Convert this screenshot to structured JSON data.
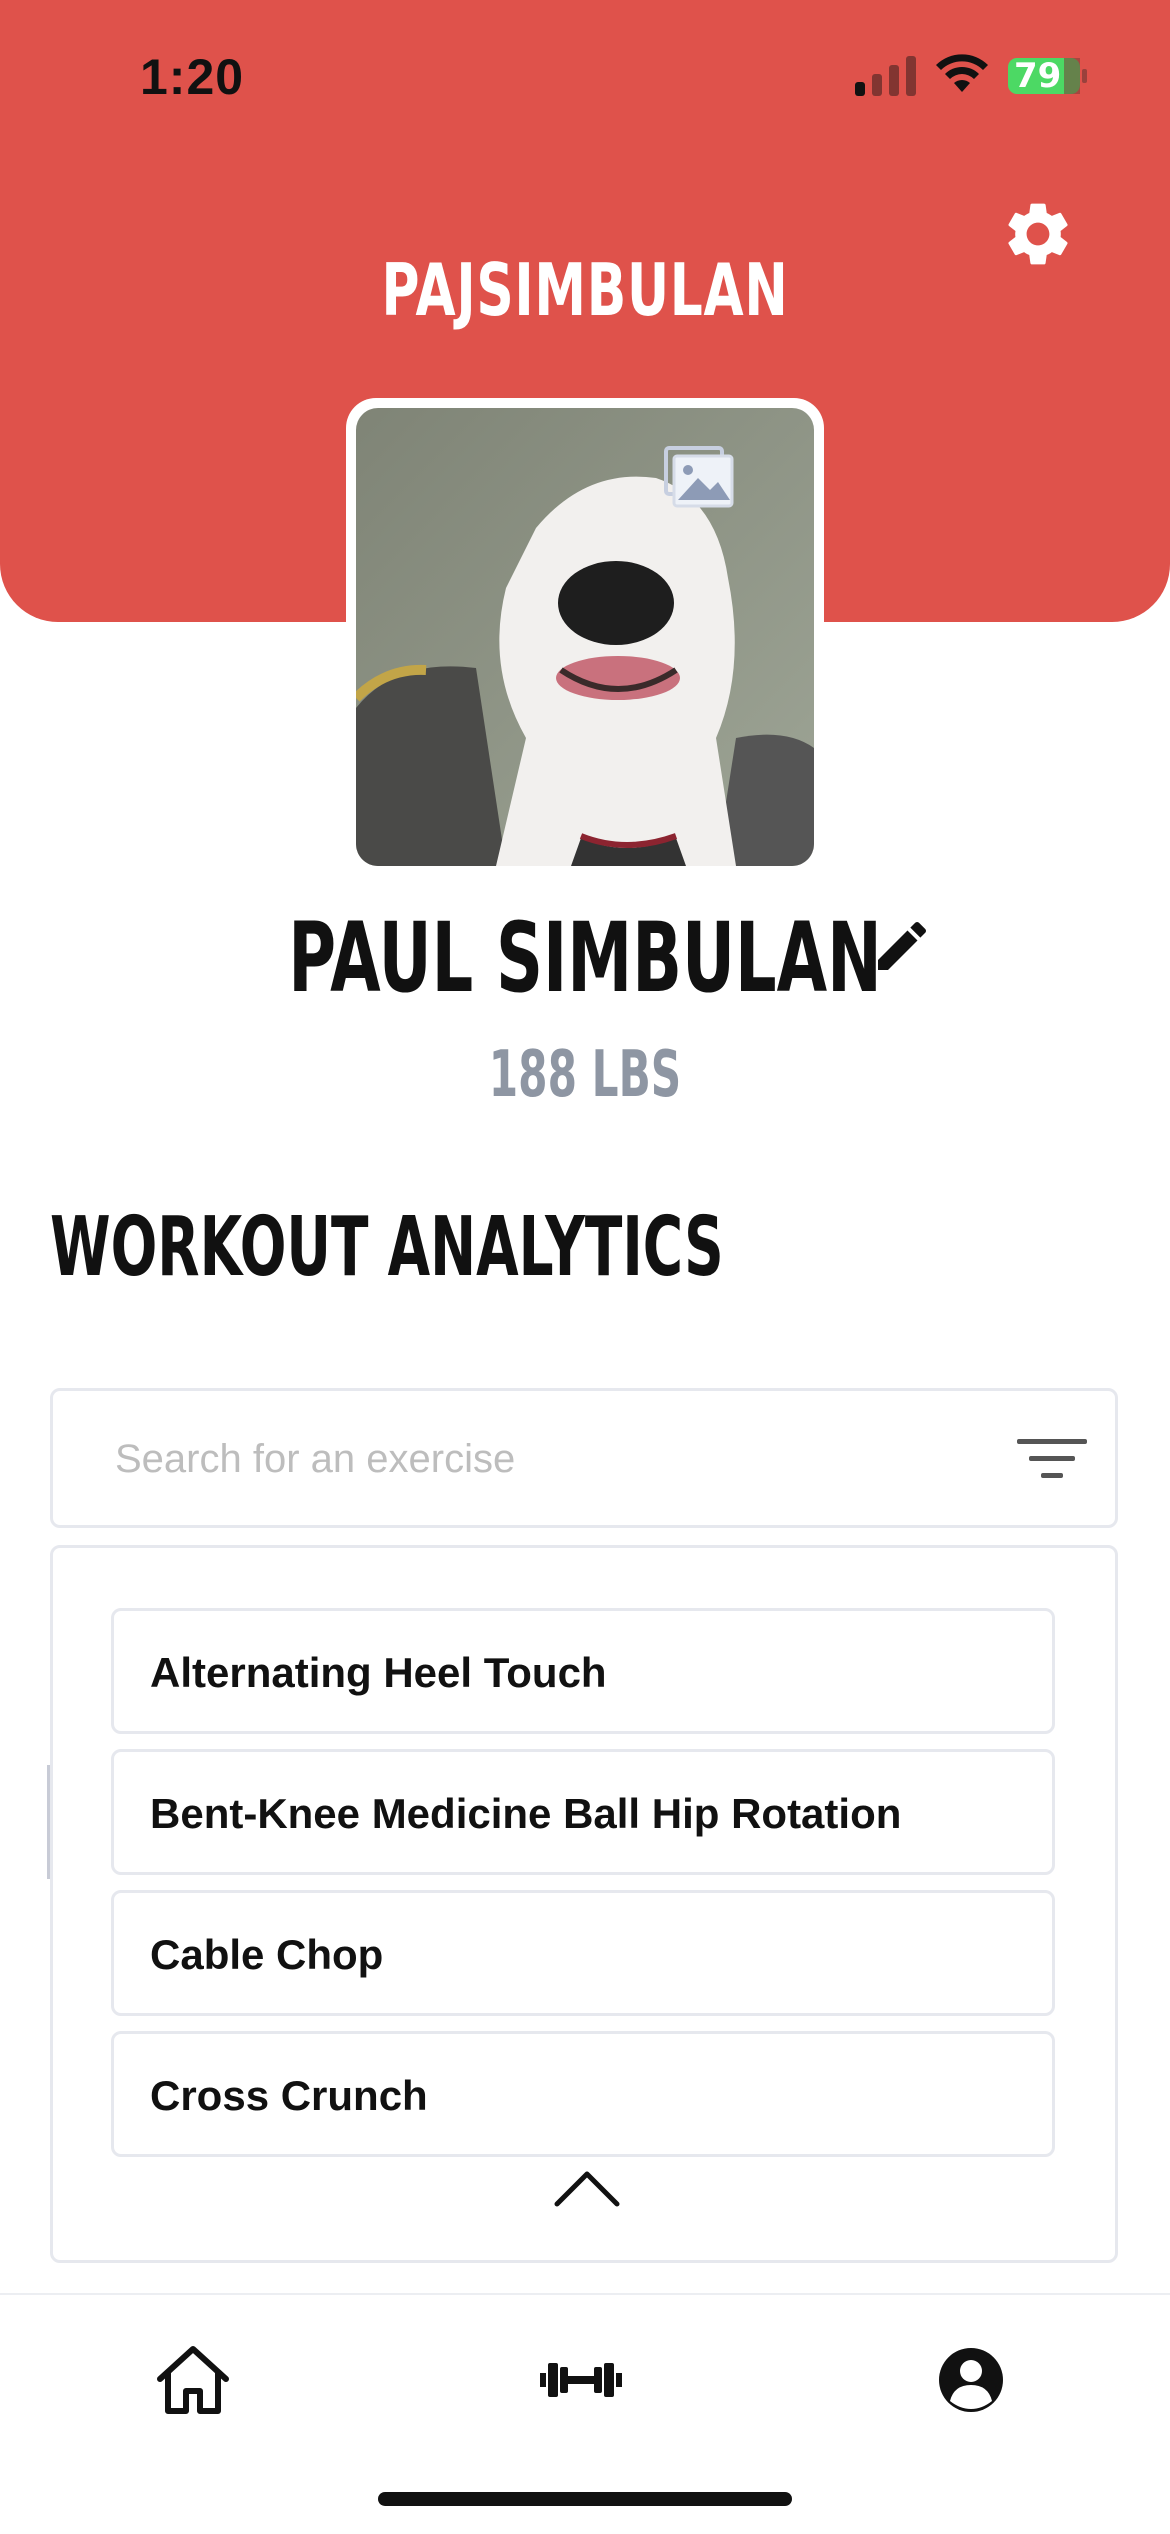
{
  "status_bar": {
    "time": "1:20",
    "battery": "79"
  },
  "header": {
    "username": "PAJSIMBULAN",
    "brand_color": "#df524b",
    "settings_icon": "gear-icon"
  },
  "profile": {
    "full_name": "PAUL SIMBULAN",
    "weight": "188 LBS",
    "edit_icon": "pencil-icon",
    "change_photo_icon": "image-icon"
  },
  "analytics": {
    "title": "WORKOUT ANALYTICS",
    "search": {
      "placeholder": "Search for an exercise",
      "value": ""
    },
    "exercises": [
      "Alternating Heel Touch",
      "Bent-Knee Medicine Ball Hip Rotation",
      "Cable Chop",
      "Cross Crunch"
    ]
  },
  "tab_bar": {
    "tabs": [
      {
        "name": "home",
        "icon": "home-icon"
      },
      {
        "name": "workouts",
        "icon": "dumbbell-icon"
      },
      {
        "name": "profile",
        "icon": "user-icon",
        "active": true
      }
    ]
  }
}
